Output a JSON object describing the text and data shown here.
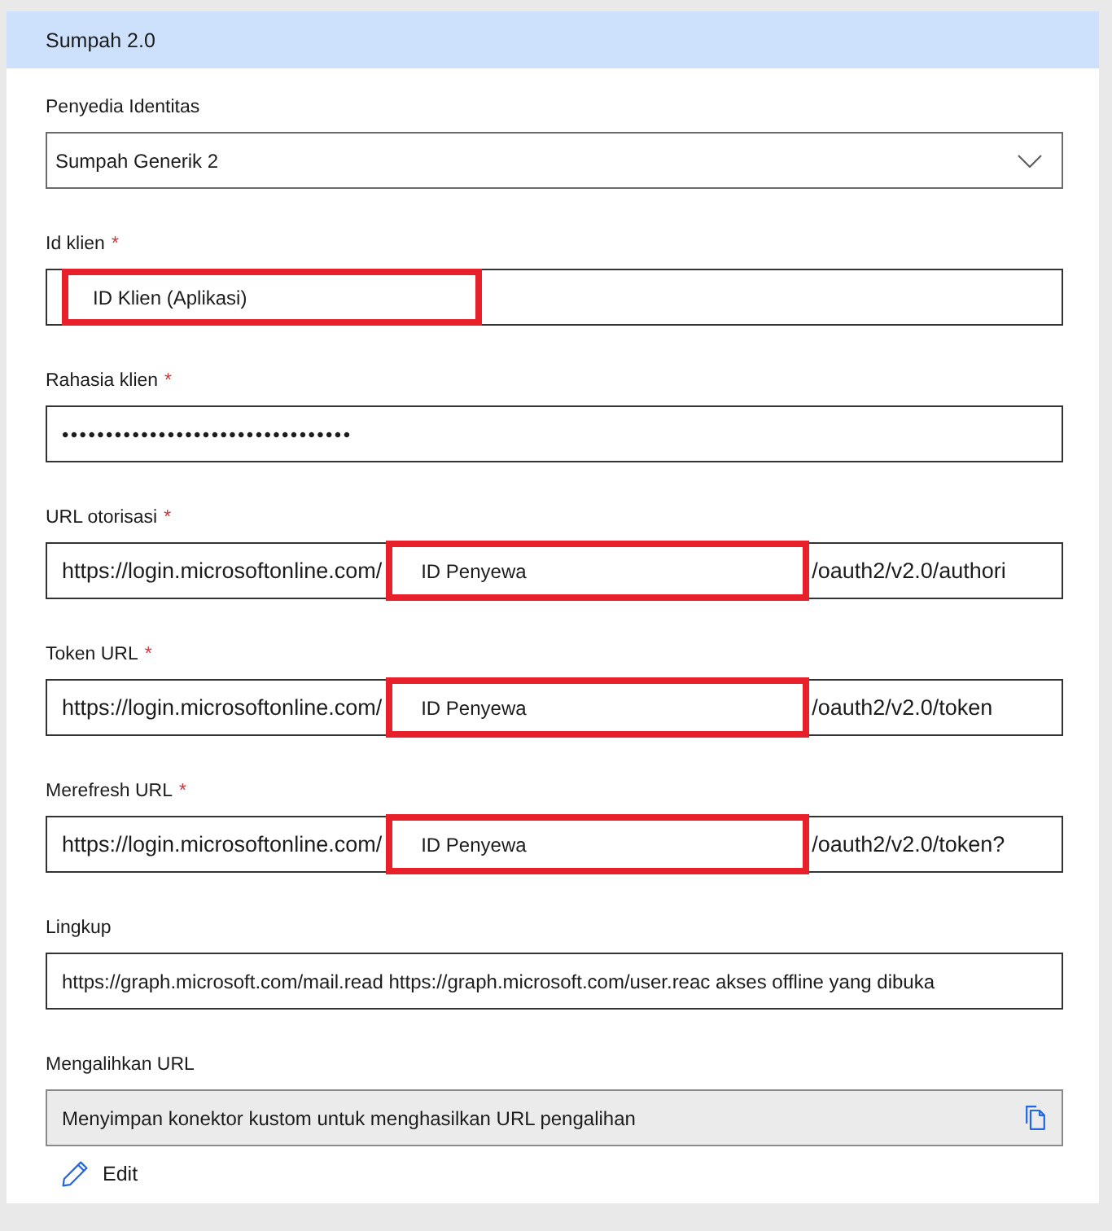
{
  "section": {
    "title": "Sumpah 2.0"
  },
  "fields": [
    {
      "kind": "dropdown",
      "label": "Penyedia Identitas",
      "value": "Sumpah Generik 2"
    },
    {
      "kind": "text",
      "label": "Id klien",
      "required_mark": "*",
      "highlight": "ID Klien (Aplikasi)"
    },
    {
      "kind": "password",
      "label": "Rahasia klien",
      "required_mark": "*",
      "value": "•••••••••••••••••••••••••••••••••"
    },
    {
      "kind": "url",
      "label": "URL otorisasi",
      "required_mark": "*",
      "prefix": "https://login.microsoftonline.com/",
      "highlight": "ID Penyewa",
      "suffix": "/oauth2/v2.0/authori"
    },
    {
      "kind": "url",
      "label": "Token URL",
      "required_mark": "*",
      "prefix": "https://login.microsoftonline.com/",
      "highlight": "ID Penyewa",
      "suffix": "/oauth2/v2.0/token"
    },
    {
      "kind": "url",
      "label": "Merefresh URL",
      "required_mark": "*",
      "prefix": "https://login.microsoftonline.com/",
      "highlight": "ID Penyewa",
      "suffix": "/oauth2/v2.0/token?"
    },
    {
      "kind": "text",
      "label": "Lingkup",
      "value": "https://graph.microsoft.com/mail.read https://graph.microsoft.com/user.reac akses offline yang dibuka"
    },
    {
      "kind": "readonly",
      "label": "Mengalihkan URL",
      "value": "Menyimpan konektor kustom untuk menghasilkan URL pengalihan"
    }
  ],
  "edit_link": {
    "label": "Edit"
  }
}
